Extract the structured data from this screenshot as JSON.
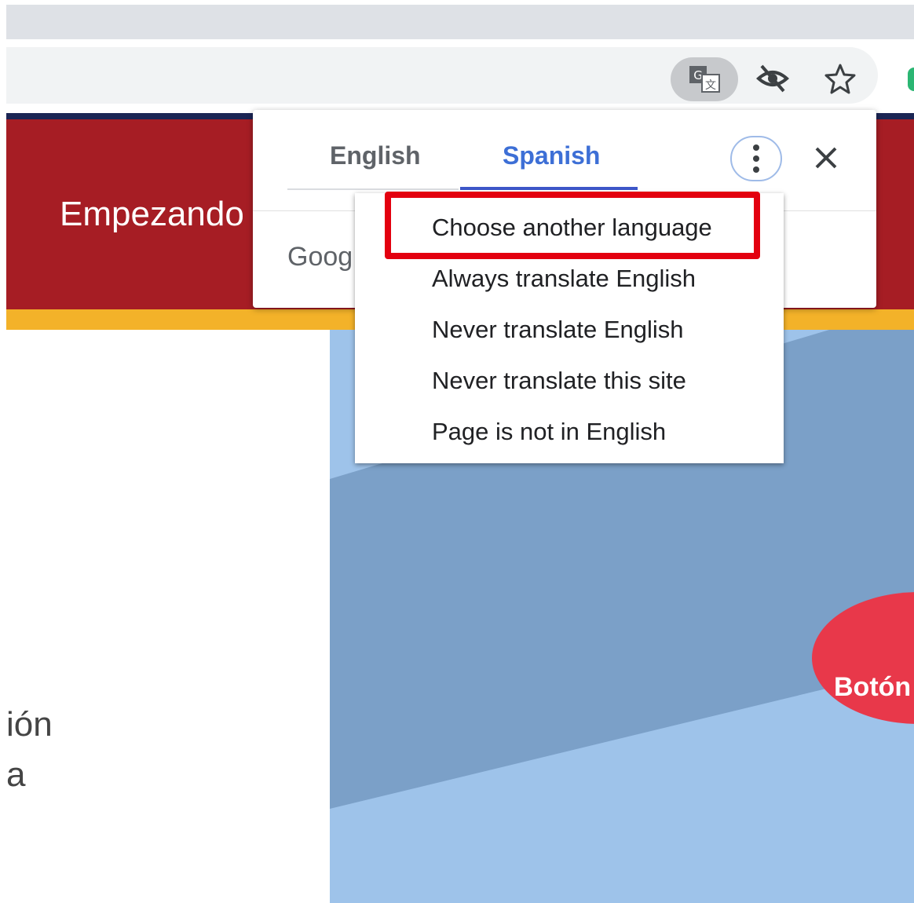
{
  "page": {
    "header_title": "Empezando",
    "hero_button_label": "Botón",
    "text_fragment_1": "ión",
    "text_fragment_2": "a"
  },
  "toolbar": {
    "icons": [
      "translate-icon",
      "eye-off-icon",
      "star-icon"
    ]
  },
  "translate_bubble": {
    "tabs": [
      {
        "label": "English",
        "selected": false
      },
      {
        "label": "Spanish",
        "selected": true
      }
    ],
    "google_text": "Goog",
    "menu": {
      "items": [
        {
          "label": "Choose another language",
          "highlighted": true
        },
        {
          "label": "Always translate English"
        },
        {
          "label": "Never translate English"
        },
        {
          "label": "Never translate this site"
        },
        {
          "label": "Page is not in English"
        }
      ]
    }
  },
  "colors": {
    "header_red": "#a61d24",
    "gold_stripe": "#f3b229",
    "navy_line": "#1b2554",
    "selected_tab_blue": "#3d6fd6",
    "highlight_red": "#e3000f",
    "hero_pill_red": "#e8384a"
  }
}
